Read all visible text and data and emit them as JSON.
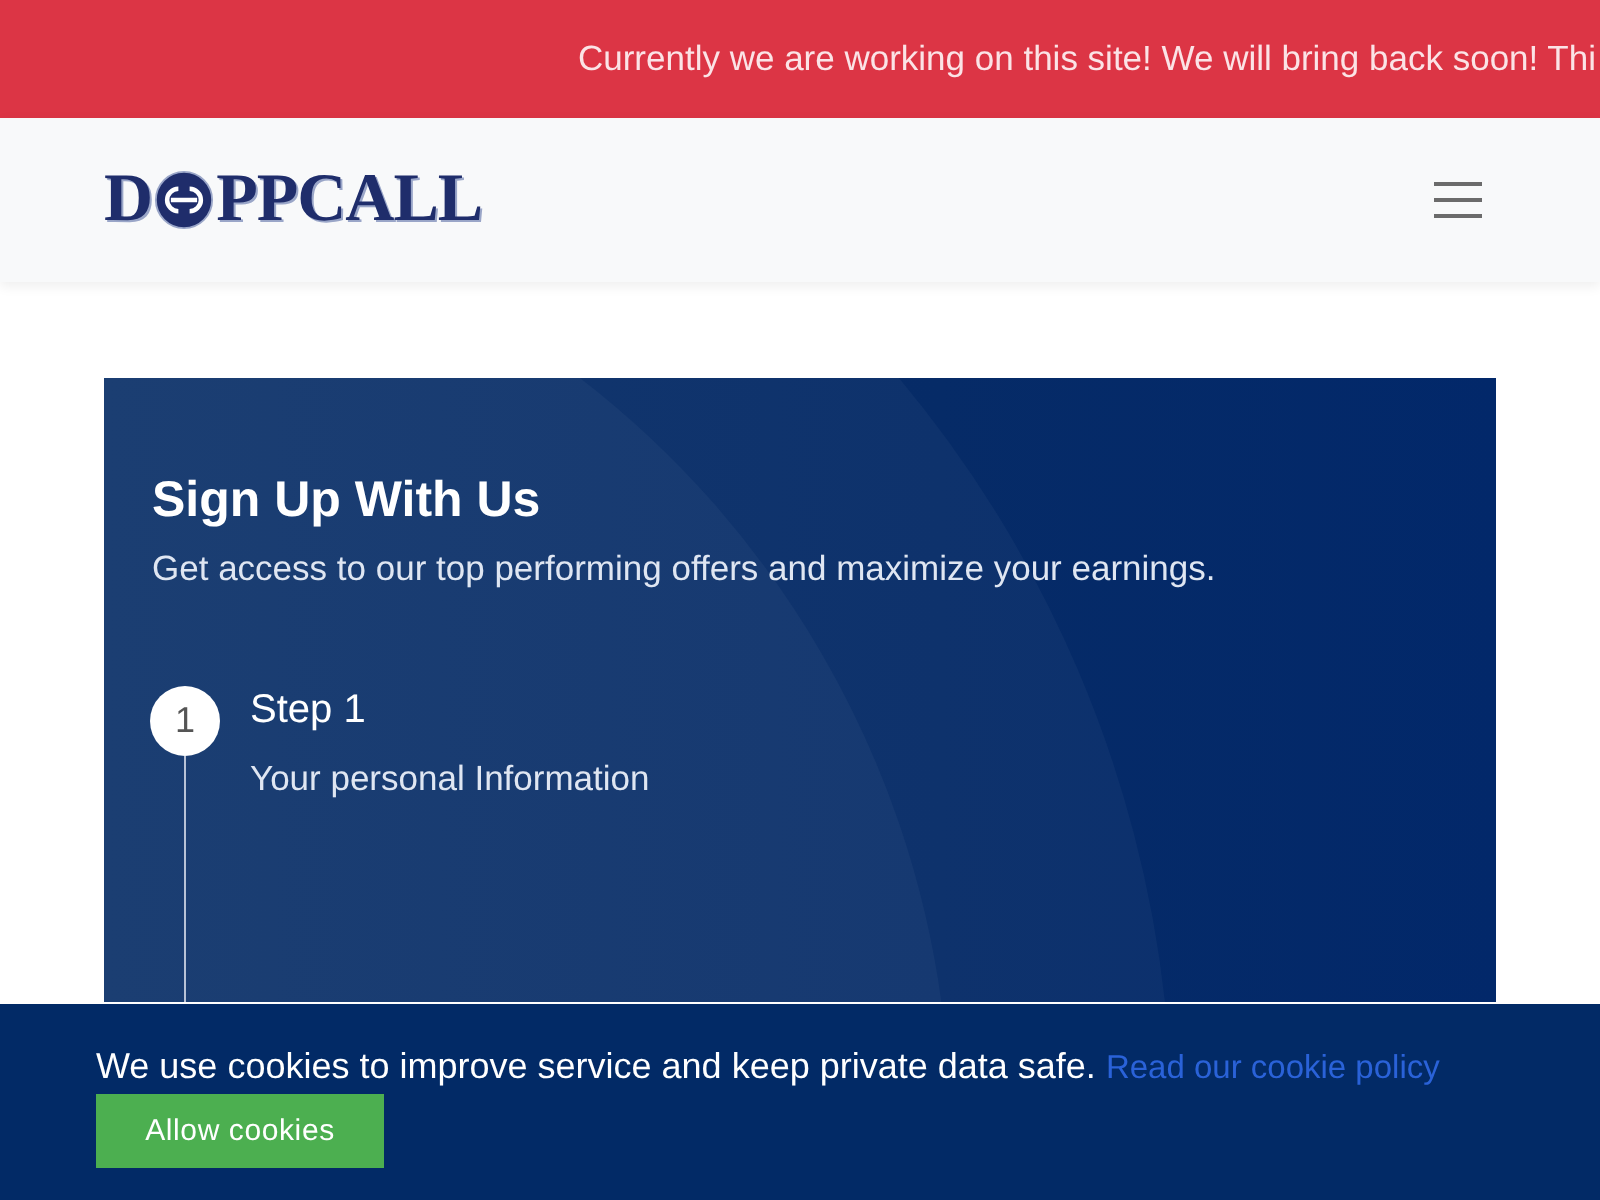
{
  "announcement": {
    "text": "Currently we are working on this site! We will bring back soon! Thi"
  },
  "navbar": {
    "logo": {
      "lead": "D",
      "rest": "PPCALL"
    }
  },
  "signup": {
    "title": "Sign Up With Us",
    "subtitle": "Get access to our top performing offers and maximize your earnings.",
    "steps": [
      {
        "number": "1",
        "title": "Step 1",
        "description": "Your personal Information"
      }
    ]
  },
  "cookie_banner": {
    "message": "We use cookies to improve service and keep private data safe.",
    "link": "Read our cookie policy",
    "button": "Allow cookies"
  }
}
